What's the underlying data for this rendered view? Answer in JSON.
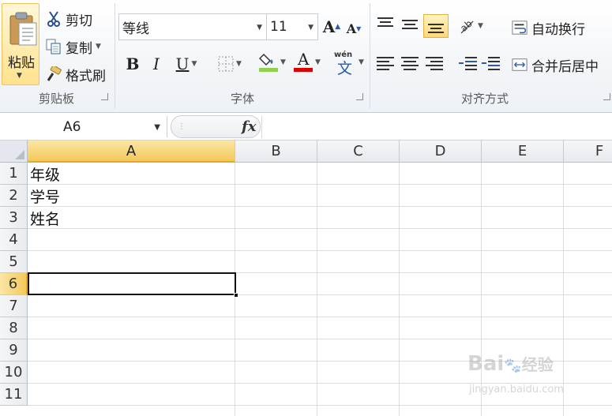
{
  "ribbon": {
    "clipboard": {
      "paste_label": "粘贴",
      "cut_label": "剪切",
      "copy_label": "复制",
      "format_painter_label": "格式刷",
      "group_label": "剪贴板"
    },
    "font": {
      "font_name": "等线",
      "font_size": "11",
      "grow_font": "A",
      "shrink_font": "A",
      "bold": "B",
      "italic": "I",
      "underline": "U",
      "font_color_letter": "A",
      "phonetic_top": "wén",
      "phonetic_char": "文",
      "group_label": "字体",
      "fill_color": "#92d050",
      "font_color": "#e00000"
    },
    "alignment": {
      "wrap_text_label": "自动换行",
      "merge_center_label": "合并后居中",
      "group_label": "对齐方式"
    }
  },
  "formula_bar": {
    "name_box": "A6",
    "fx_label": "fx",
    "formula_value": ""
  },
  "sheet": {
    "columns": [
      "A",
      "B",
      "C",
      "D",
      "E",
      "F"
    ],
    "rows": [
      "1",
      "2",
      "3",
      "4",
      "5",
      "6",
      "7",
      "8",
      "9",
      "10",
      "11"
    ],
    "selected_column": "A",
    "selected_row": "6",
    "cells": {
      "A1": "年级",
      "A2": "学号",
      "A3": "姓名"
    }
  },
  "watermark": {
    "brand": "Bai",
    "brand_suffix": "经验",
    "url": "jingyan.baidu.com"
  }
}
